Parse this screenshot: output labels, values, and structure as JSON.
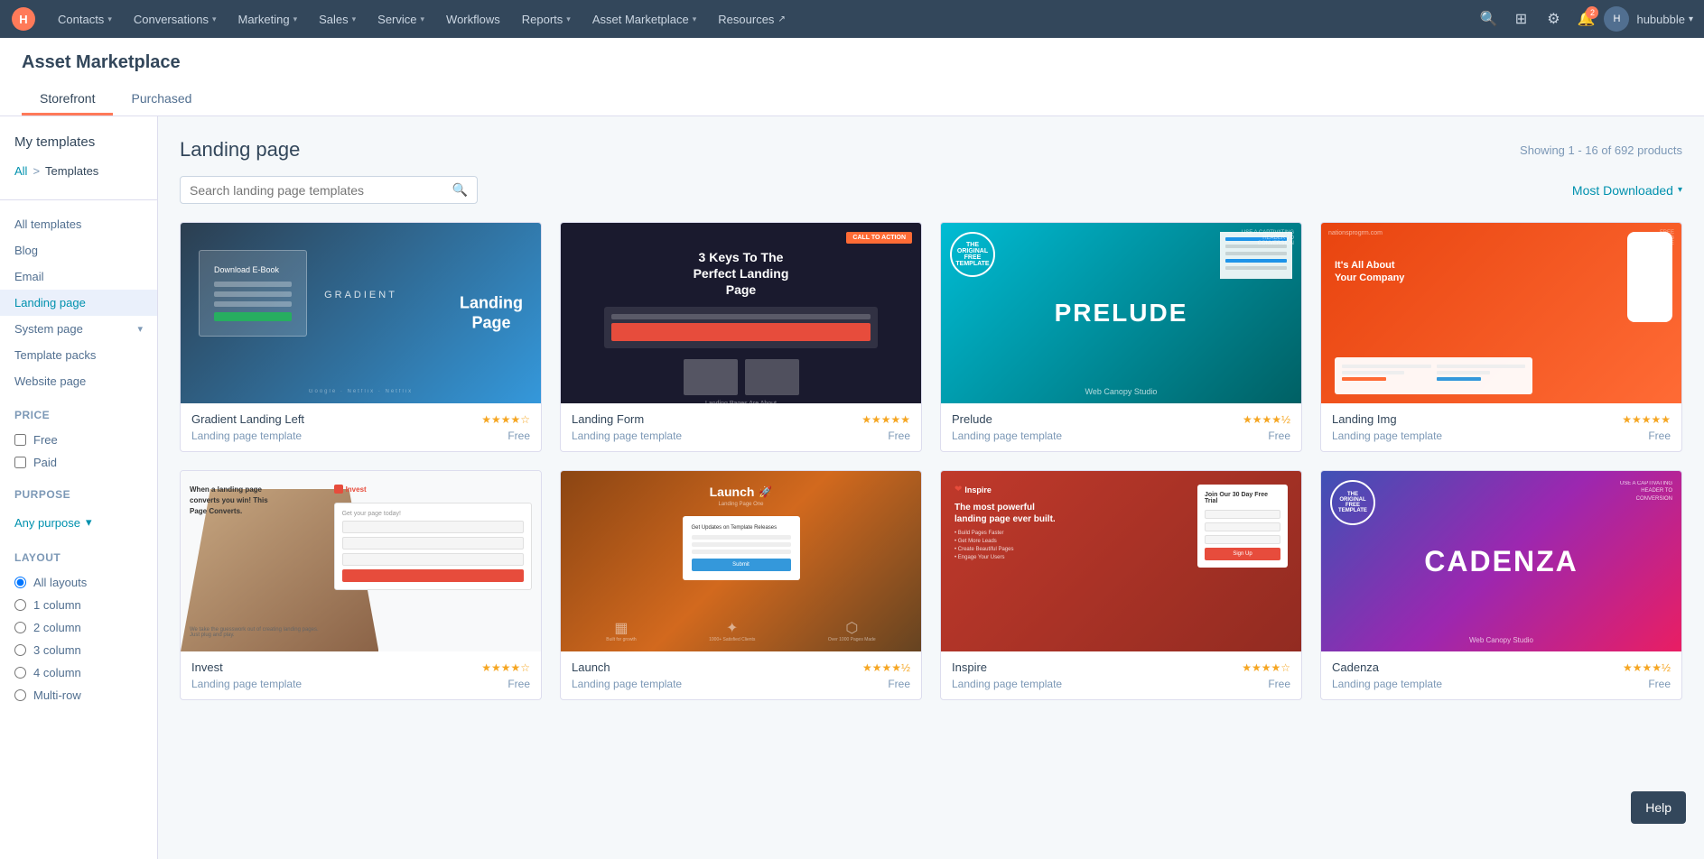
{
  "nav": {
    "items": [
      {
        "label": "Contacts",
        "hasDropdown": true
      },
      {
        "label": "Conversations",
        "hasDropdown": true
      },
      {
        "label": "Marketing",
        "hasDropdown": true
      },
      {
        "label": "Sales",
        "hasDropdown": true
      },
      {
        "label": "Service",
        "hasDropdown": true
      },
      {
        "label": "Workflows",
        "hasDropdown": false
      },
      {
        "label": "Reports",
        "hasDropdown": true
      },
      {
        "label": "Asset Marketplace",
        "hasDropdown": true
      },
      {
        "label": "Resources",
        "hasDropdown": true,
        "external": true
      }
    ],
    "username": "hububble",
    "notification_count": "2"
  },
  "page": {
    "title": "Asset Marketplace",
    "tabs": [
      {
        "label": "Storefront",
        "active": true
      },
      {
        "label": "Purchased",
        "active": false
      }
    ]
  },
  "sidebar": {
    "my_templates": "My templates",
    "breadcrumb": {
      "all": "All",
      "separator": ">",
      "current": "Templates"
    },
    "nav_items": [
      {
        "label": "All templates",
        "active": false
      },
      {
        "label": "Blog",
        "active": false
      },
      {
        "label": "Email",
        "active": false
      },
      {
        "label": "Landing page",
        "active": true
      },
      {
        "label": "System page",
        "active": false,
        "expandable": true
      },
      {
        "label": "Template packs",
        "active": false
      },
      {
        "label": "Website page",
        "active": false
      }
    ],
    "price_section": "Price",
    "price_options": [
      {
        "label": "Free",
        "checked": false
      },
      {
        "label": "Paid",
        "checked": false
      }
    ],
    "purpose_section": "Purpose",
    "purpose_value": "Any purpose",
    "layout_section": "Layout",
    "layout_options": [
      {
        "label": "All layouts",
        "checked": true
      },
      {
        "label": "1 column",
        "checked": false
      },
      {
        "label": "2 column",
        "checked": false
      },
      {
        "label": "3 column",
        "checked": false
      },
      {
        "label": "4 column",
        "checked": false
      },
      {
        "label": "Multi-row",
        "checked": false
      }
    ]
  },
  "content": {
    "title": "Landing page",
    "showing_text": "Showing 1 - 16 of 692 products",
    "search_placeholder": "Search landing page templates",
    "sort_label": "Most Downloaded",
    "templates": [
      {
        "id": 1,
        "name": "Gradient Landing Left",
        "type": "Landing page template",
        "price": "Free",
        "stars": 4.0,
        "thumbnail_type": "gradient"
      },
      {
        "id": 2,
        "name": "Landing Form",
        "type": "Landing page template",
        "price": "Free",
        "stars": 5.0,
        "thumbnail_type": "landing-form"
      },
      {
        "id": 3,
        "name": "Prelude",
        "type": "Landing page template",
        "price": "Free",
        "stars": 4.5,
        "thumbnail_type": "prelude"
      },
      {
        "id": 4,
        "name": "Landing Img",
        "type": "Landing page template",
        "price": "Free",
        "stars": 5.0,
        "thumbnail_type": "landing-img"
      },
      {
        "id": 5,
        "name": "Invest",
        "type": "Landing page template",
        "price": "Free",
        "stars": 4.0,
        "thumbnail_type": "invest"
      },
      {
        "id": 6,
        "name": "Launch",
        "type": "Landing page template",
        "price": "Free",
        "stars": 4.5,
        "thumbnail_type": "launch"
      },
      {
        "id": 7,
        "name": "Inspire",
        "type": "Landing page template",
        "price": "Free",
        "stars": 4.0,
        "thumbnail_type": "inspire"
      },
      {
        "id": 8,
        "name": "Cadenza",
        "type": "Landing page template",
        "price": "Free",
        "stars": 4.5,
        "thumbnail_type": "cadenza"
      }
    ]
  },
  "help_button": "Help"
}
